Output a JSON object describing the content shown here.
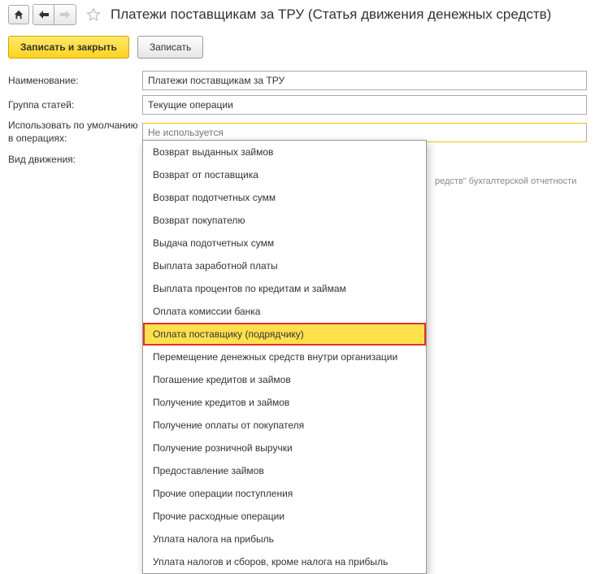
{
  "header": {
    "title": "Платежи поставщикам за ТРУ (Статья движения денежных средств)"
  },
  "actions": {
    "save_close": "Записать и закрыть",
    "save": "Записать"
  },
  "labels": {
    "name": "Наименование:",
    "group": "Группа статей:",
    "default_ops": "Использовать по умолчанию в операциях:",
    "movement": "Вид движения:"
  },
  "fields": {
    "name_value": "Платежи поставщикам за ТРУ",
    "group_value": "Текущие операции",
    "default_ops_placeholder": "Не используется"
  },
  "hint_suffix": "редств\" бухгалтерской отчетности",
  "dropdown": {
    "items": [
      {
        "label": "Возврат выданных займов"
      },
      {
        "label": "Возврат от поставщика"
      },
      {
        "label": "Возврат подотчетных сумм"
      },
      {
        "label": "Возврат покупателю"
      },
      {
        "label": "Выдача подотчетных сумм"
      },
      {
        "label": "Выплата заработной платы"
      },
      {
        "label": "Выплата процентов по кредитам и займам"
      },
      {
        "label": "Оплата комиссии банка"
      },
      {
        "label": "Оплата поставщику (подрядчику)",
        "selected": true
      },
      {
        "label": "Перемещение денежных средств внутри организации"
      },
      {
        "label": "Погашение кредитов и займов"
      },
      {
        "label": "Получение кредитов и займов"
      },
      {
        "label": "Получение оплаты от покупателя"
      },
      {
        "label": "Получение розничной выручки"
      },
      {
        "label": "Предоставление займов"
      },
      {
        "label": "Прочие операции поступления"
      },
      {
        "label": "Прочие расходные операции"
      },
      {
        "label": "Уплата налога на прибыль"
      },
      {
        "label": "Уплата налогов и сборов, кроме налога на прибыль"
      }
    ]
  }
}
